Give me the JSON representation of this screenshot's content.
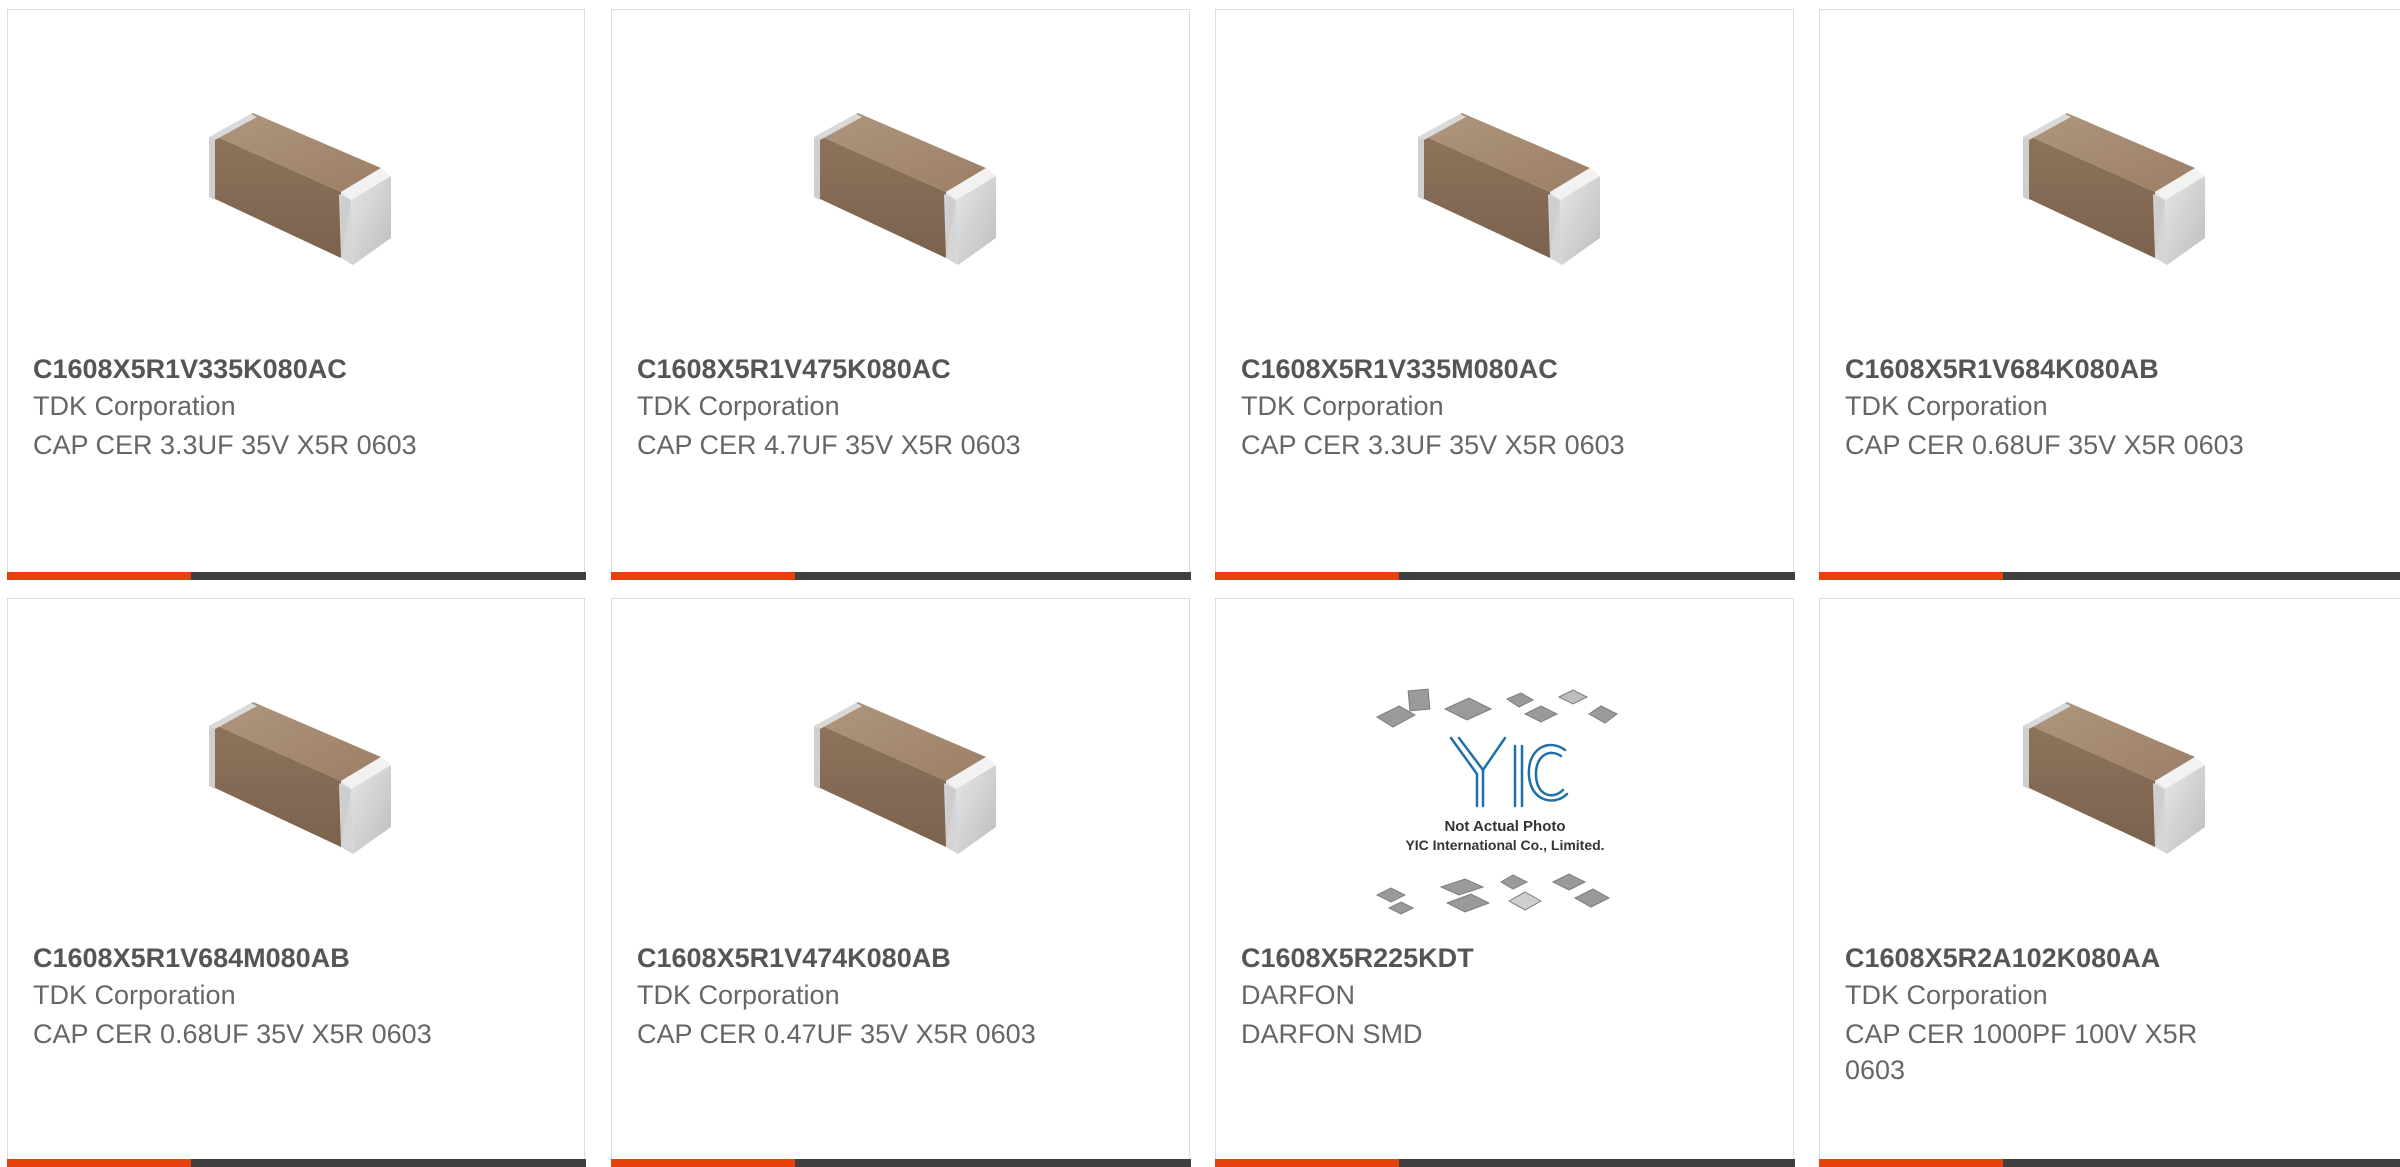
{
  "colors": {
    "accent": "#e8400c",
    "bar_dark": "#3f3f3f",
    "border": "#dcdcdc",
    "part_text": "#555555",
    "body_text": "#666666"
  },
  "products": [
    {
      "part_number": "C1608X5R1V335K080AC",
      "manufacturer": "TDK Corporation",
      "description": "CAP CER 3.3UF 35V X5R 0603",
      "image": "capacitor-chip-image"
    },
    {
      "part_number": "C1608X5R1V475K080AC",
      "manufacturer": "TDK Corporation",
      "description": "CAP CER 4.7UF 35V X5R 0603",
      "image": "capacitor-chip-image"
    },
    {
      "part_number": "C1608X5R1V335M080AC",
      "manufacturer": "TDK Corporation",
      "description": "CAP CER 3.3UF 35V X5R 0603",
      "image": "capacitor-chip-image"
    },
    {
      "part_number": "C1608X5R1V684K080AB",
      "manufacturer": "TDK Corporation",
      "description": "CAP CER 0.68UF 35V X5R 0603",
      "image": "capacitor-chip-image"
    },
    {
      "part_number": "C1608X5R1V684M080AB",
      "manufacturer": "TDK Corporation",
      "description": "CAP CER 0.68UF 35V X5R 0603",
      "image": "capacitor-chip-image"
    },
    {
      "part_number": "C1608X5R1V474K080AB",
      "manufacturer": "TDK Corporation",
      "description": "CAP CER 0.47UF 35V X5R 0603",
      "image": "capacitor-chip-image"
    },
    {
      "part_number": "C1608X5R225KDT",
      "manufacturer": "DARFON",
      "description": "DARFON SMD",
      "image": "yic-placeholder-image",
      "image_text": {
        "logo": "YIC",
        "line1": "Not Actual Photo",
        "line2": "YIC International Co., Limited."
      }
    },
    {
      "part_number": "C1608X5R2A102K080AA",
      "manufacturer": "TDK Corporation",
      "description": "CAP CER 1000PF 100V X5R 0603",
      "image": "capacitor-chip-image"
    }
  ]
}
